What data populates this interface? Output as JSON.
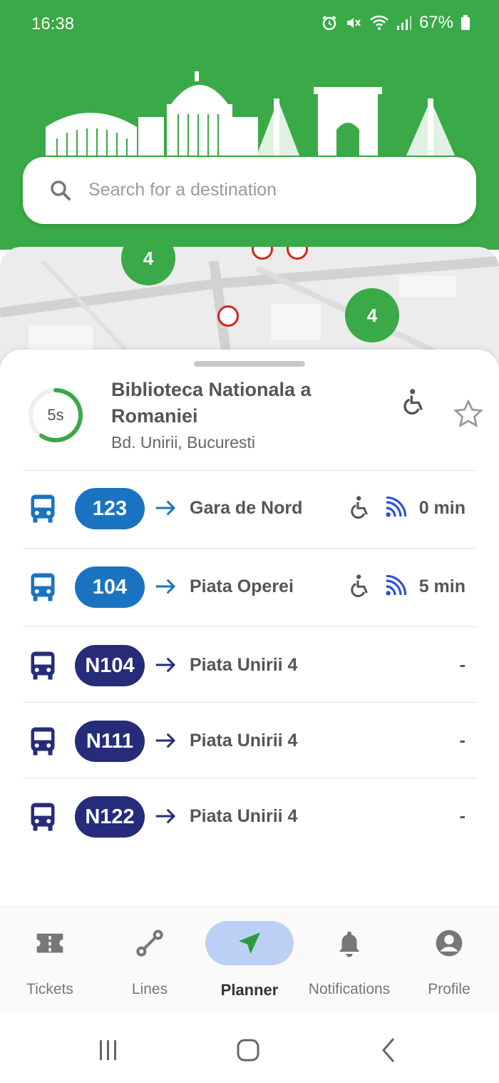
{
  "status_bar": {
    "time": "16:38",
    "battery": "67%"
  },
  "search": {
    "placeholder": "Search for a destination"
  },
  "map": {
    "clusters": [
      "4",
      "4"
    ]
  },
  "stop": {
    "timer": "5s",
    "name": "Biblioteca Nationala a Romaniei",
    "address": "Bd. Unirii, Bucuresti"
  },
  "departures": [
    {
      "line": "123",
      "destination": "Gara de Nord",
      "eta": "0 min",
      "badge_color": "#1a73c1",
      "accessible": true,
      "realtime": true
    },
    {
      "line": "104",
      "destination": "Piata Operei",
      "eta": "5 min",
      "badge_color": "#1a73c1",
      "accessible": true,
      "realtime": true
    },
    {
      "line": "N104",
      "destination": "Piata Unirii 4",
      "eta": "-",
      "badge_color": "#262c7a",
      "accessible": false,
      "realtime": false
    },
    {
      "line": "N111",
      "destination": "Piata Unirii 4",
      "eta": "-",
      "badge_color": "#262c7a",
      "accessible": false,
      "realtime": false
    },
    {
      "line": "N122",
      "destination": "Piata Unirii 4",
      "eta": "-",
      "badge_color": "#262c7a",
      "accessible": false,
      "realtime": false
    }
  ],
  "nav": {
    "items": [
      {
        "label": "Tickets",
        "icon": "ticket-icon"
      },
      {
        "label": "Lines",
        "icon": "route-icon"
      },
      {
        "label": "Planner",
        "icon": "navigation-arrow-icon",
        "active": true
      },
      {
        "label": "Notifications",
        "icon": "bell-icon"
      },
      {
        "label": "Profile",
        "icon": "account-circle-icon"
      }
    ]
  },
  "colors": {
    "brand_green": "#3aa947",
    "day_line_blue": "#1a73c1",
    "night_line_navy": "#262c7a",
    "stop_red": "#d8231f",
    "active_nav_pill": "#bcd0f6"
  }
}
